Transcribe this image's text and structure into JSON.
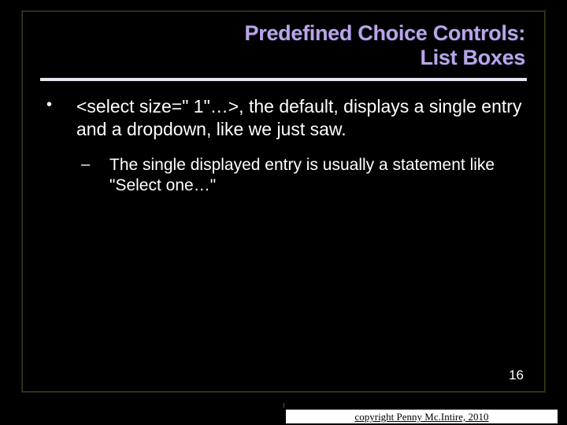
{
  "title_line1": "Predefined Choice Controls:",
  "title_line2": "List Boxes",
  "bullet": {
    "marker": "•",
    "text": "<select size=\" 1\"…>, the default, displays a single entry and a dropdown, like we just saw."
  },
  "subbullet": {
    "marker": "–",
    "text": "The single displayed entry is usually a statement like \"Select one…\""
  },
  "page_number": "16",
  "copyright": "copyright Penny Mc.Intire, 2010"
}
